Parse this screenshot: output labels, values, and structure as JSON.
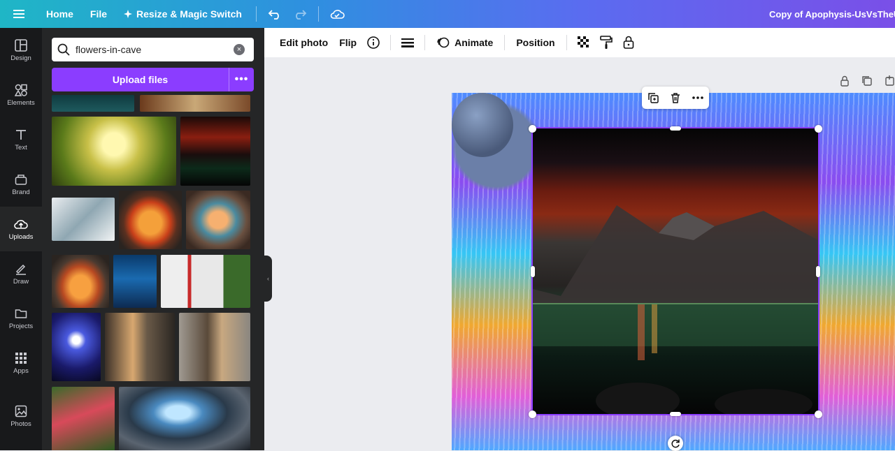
{
  "topbar": {
    "menu_icon": "hamburger-icon",
    "home": "Home",
    "file": "File",
    "resize": "Resize & Magic Switch",
    "doc_title": "Copy of Apophysis-UsVsTheU"
  },
  "rail": {
    "items": [
      {
        "label": "Design",
        "icon": "design-icon"
      },
      {
        "label": "Elements",
        "icon": "elements-icon"
      },
      {
        "label": "Text",
        "icon": "text-icon"
      },
      {
        "label": "Brand",
        "icon": "brand-icon"
      },
      {
        "label": "Uploads",
        "icon": "upload-cloud-icon",
        "active": true
      },
      {
        "label": "Draw",
        "icon": "draw-icon"
      },
      {
        "label": "Projects",
        "icon": "folder-icon"
      },
      {
        "label": "Apps",
        "icon": "apps-grid-icon"
      },
      {
        "label": "Photos",
        "icon": "photos-icon"
      }
    ]
  },
  "panel": {
    "search_value": "flowers-in-cave",
    "upload_label": "Upload files",
    "more_label": "•••"
  },
  "context_toolbar": {
    "edit_photo": "Edit photo",
    "flip": "Flip",
    "animate": "Animate",
    "position": "Position"
  },
  "colors": {
    "accent": "#8b3dff",
    "rail_bg": "#18191b",
    "panel_bg": "#252627"
  }
}
